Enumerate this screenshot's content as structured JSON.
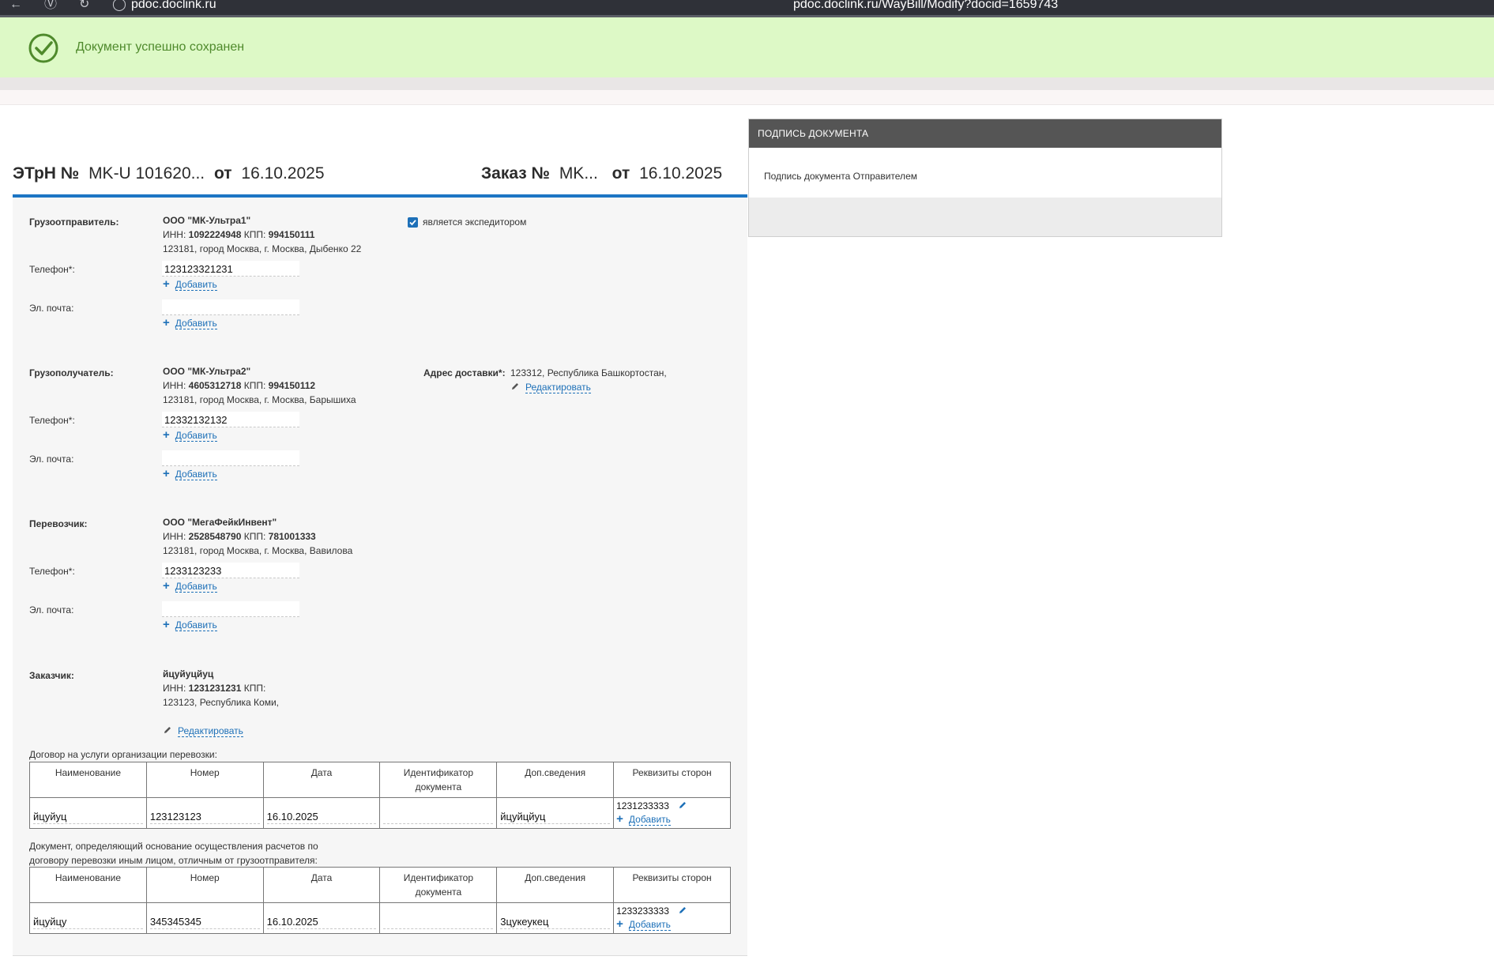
{
  "browser": {
    "host": "pdoc.doclink.ru",
    "url": "pdoc.doclink.ru/WayBill/Modify?docid=1659743"
  },
  "notice": {
    "message": "Документ успешно сохранен"
  },
  "header": {
    "doc_label": "ЭТрН №",
    "doc_number": "MK-U 101620...",
    "from_label": "от",
    "doc_date": "16.10.2025",
    "order_label": "Заказ №",
    "order_number": "MK...",
    "order_from_label": "от",
    "order_date": "16.10.2025"
  },
  "common": {
    "phone_label": "Телефон*:",
    "email_label": "Эл. почта:",
    "add_label": "Добавить",
    "edit_label": "Редактировать",
    "inn_label": "ИНН:",
    "kpp_label": "КПП:"
  },
  "shipper": {
    "label": "Грузоотправитель:",
    "name": "ООО \"МК-Ультра1\"",
    "inn": "1092224948",
    "kpp": "994150111",
    "address": "123181, город Москва, г. Москва, Дыбенко 22",
    "phone": "123123321231",
    "email": "",
    "forwarder_checked": true,
    "forwarder_label": "является экспедитором"
  },
  "consignee": {
    "label": "Грузополучатель:",
    "name": "ООО \"МК-Ультра2\"",
    "inn": "4605312718",
    "kpp": "994150112",
    "address": "123181, город Москва, г. Москва, Барышиха",
    "phone": "12332132132",
    "email": "",
    "delivery_label": "Адрес доставки*:",
    "delivery_address": "123312, Республика Башкортостан,"
  },
  "carrier": {
    "label": "Перевозчик:",
    "name": "ООО \"МегаФейкИнвент\"",
    "inn": "2528548790",
    "kpp": "781001333",
    "address": "123181, город Москва, г. Москва, Вавилова",
    "phone": "1233123233",
    "email": ""
  },
  "customer": {
    "label": "Заказчик:",
    "name": "йцуйуцйуц",
    "inn": "1231231231",
    "kpp": "",
    "address": "123123, Республика Коми,"
  },
  "contract_section": {
    "label": "Договор на услуги организации перевозки:",
    "columns": [
      "Наименование",
      "Номер",
      "Дата",
      "Идентификатор документа",
      "Доп.сведения",
      "Реквизиты сторон"
    ],
    "row": {
      "name": "йцуйуц",
      "number": "123123123",
      "date": "16.10.2025",
      "identifier": "",
      "extra": "йцуйцйуц",
      "requisites": "1231233333"
    }
  },
  "basis_section": {
    "label_line1": "Документ, определяющий основание осуществления расчетов по",
    "label_line2": "договору перевозки иным лицом, отличным от грузоотправителя:",
    "columns": [
      "Наименование",
      "Номер",
      "Дата",
      "Идентификатор документа",
      "Доп.сведения",
      "Реквизиты сторон"
    ],
    "row": {
      "name": "йцуйцу",
      "number": "345345345",
      "date": "16.10.2025",
      "identifier": "",
      "extra": "3цукеукец",
      "requisites": "1233233333"
    }
  },
  "signature": {
    "title": "ПОДПИСЬ ДОКУМЕНТА",
    "text": "Подпись документа Отправителем"
  },
  "colors": {
    "accent_blue": "#1c75c4",
    "link_blue": "#1d70b8",
    "success_bg": "#ddf9c6",
    "success_text": "#4f8a2c",
    "panel_header": "#555555"
  }
}
